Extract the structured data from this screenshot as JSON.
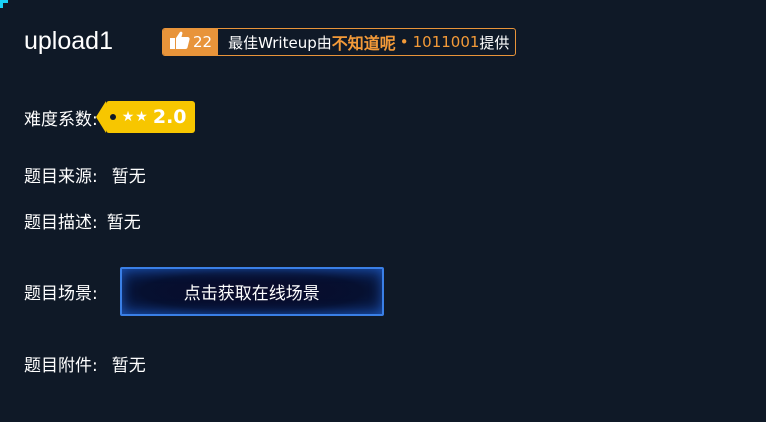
{
  "challenge": {
    "title": "upload1"
  },
  "writeup_badge": {
    "like_count": "22",
    "prefix": "最佳Writeup由",
    "author": "不知道呢",
    "separator": "•",
    "author_id": "1011001",
    "suffix": "提供",
    "accent_color": "#e8943a"
  },
  "difficulty": {
    "label": "难度系数:",
    "stars": "★★",
    "value": "2.0",
    "badge_color": "#f7c600"
  },
  "source": {
    "label": "题目来源:",
    "value": "暂无"
  },
  "description": {
    "label": "题目描述:",
    "value": "暂无"
  },
  "scene": {
    "label": "题目场景:",
    "button_label": "点击获取在线场景"
  },
  "attachment": {
    "label": "题目附件:",
    "value": "暂无"
  },
  "icons": {
    "like": "thumbs-up-icon",
    "tag_hole": "tag-hole-icon"
  }
}
